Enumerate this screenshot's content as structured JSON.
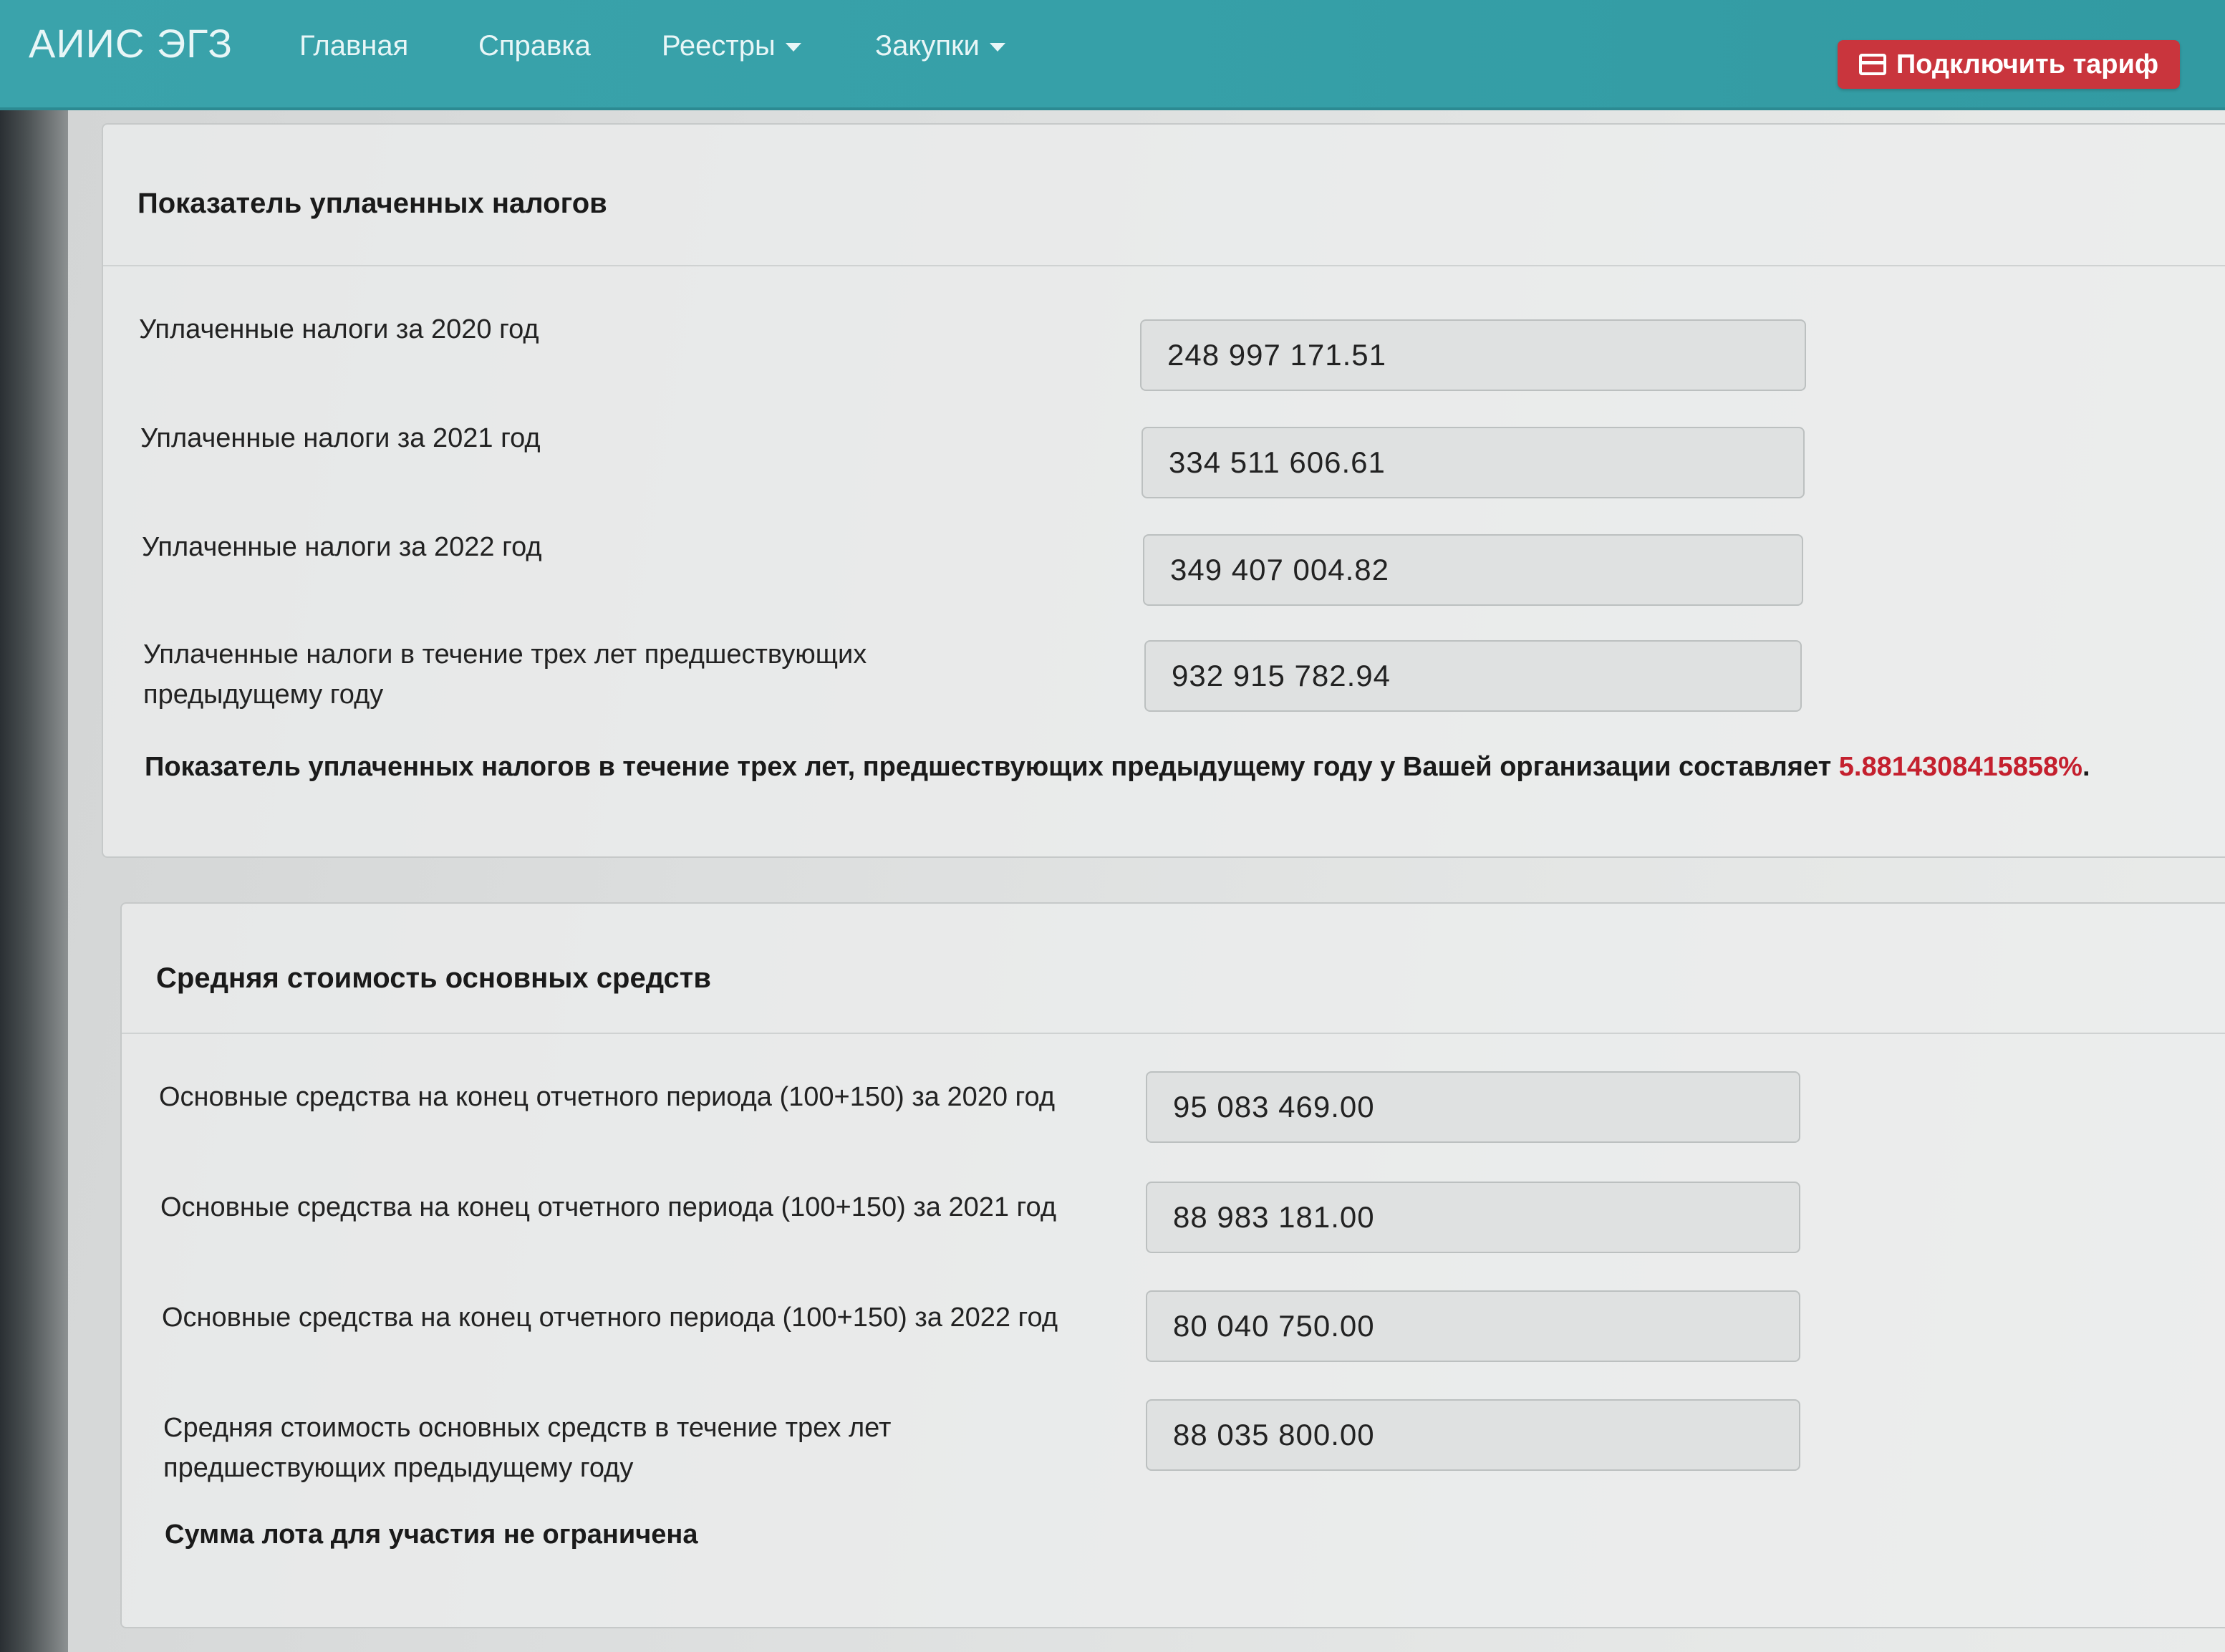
{
  "navbar": {
    "brand": "АИИС ЭГЗ",
    "items": [
      {
        "label": "Главная"
      },
      {
        "label": "Справка"
      },
      {
        "label": "Реестры"
      },
      {
        "label": "Закупки"
      }
    ],
    "tariff_button": "Подключить тариф",
    "accent_color": "#36a0a8",
    "button_color": "#c9353d"
  },
  "taxes": {
    "title": "Показатель уплаченных налогов",
    "rows": [
      {
        "label": "Уплаченные налоги за 2020 год",
        "value": "248 997 171.51"
      },
      {
        "label": "Уплаченные налоги за 2021 год",
        "value": "334 511 606.61"
      },
      {
        "label": "Уплаченные налоги за 2022 год",
        "value": "349 407 004.82"
      },
      {
        "label": "Уплаченные налоги в течение трех лет предшествующих предыдущему году",
        "value": "932 915 782.94"
      }
    ],
    "result_text": "Показатель уплаченных налогов в течение трех лет, предшествующих предыдущему году у Вашей организации составляет",
    "result_value": "5.8814308415858%",
    "result_end": ".",
    "highlight_color": "#c4202e"
  },
  "assets": {
    "title": "Средняя стоимость основных средств",
    "rows": [
      {
        "label": "Основные средства на конец отчетного периода (100+150) за 2020 год",
        "value": "95 083 469.00"
      },
      {
        "label": "Основные средства на конец отчетного периода (100+150) за 2021 год",
        "value": "88 983 181.00"
      },
      {
        "label": "Основные средства на конец отчетного периода (100+150) за 2022 год",
        "value": "80 040 750.00"
      },
      {
        "label": "Средняя стоимость основных средств в течение трех лет предшествующих предыдущему году",
        "value": "88 035 800.00"
      }
    ],
    "note": "Сумма лота для участия не ограничена"
  }
}
